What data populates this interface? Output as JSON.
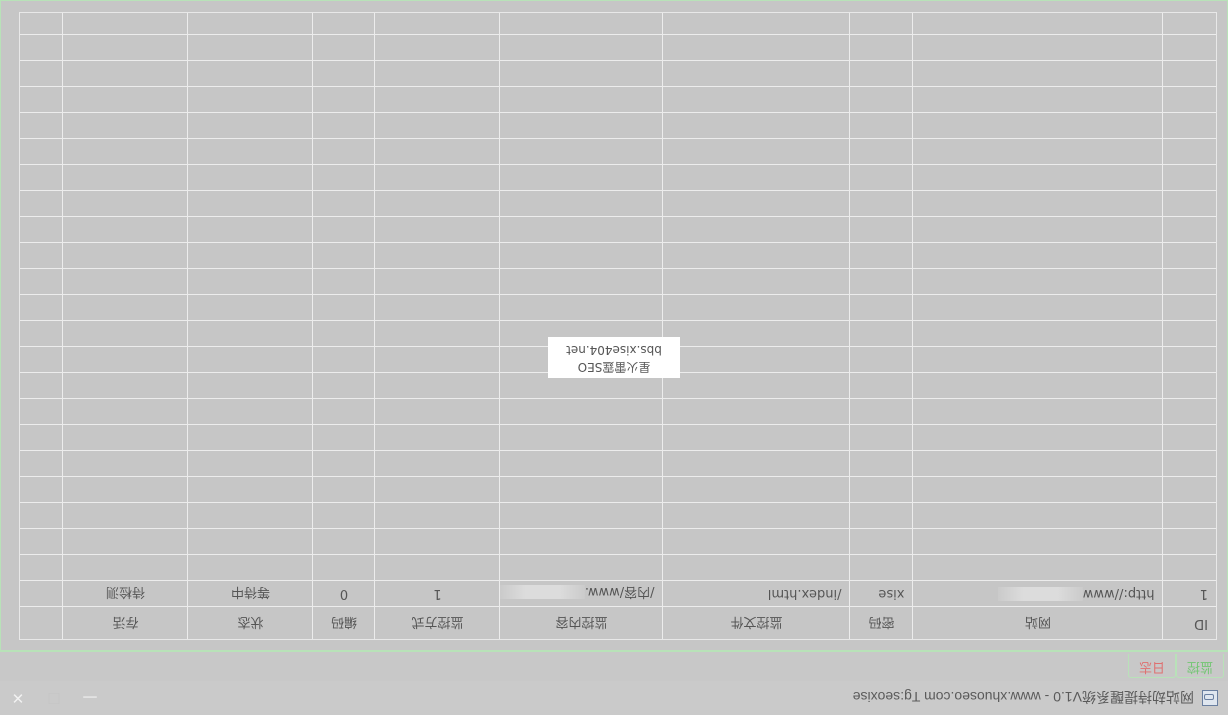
{
  "window": {
    "title": "网站劫持提醒系统V1.0 - www.xhuoseo.com Tg:seoxise",
    "controls": {
      "minimize": "—",
      "maximize": "☐",
      "close": "✕"
    }
  },
  "tabs": [
    {
      "label": "监控",
      "active": true
    },
    {
      "label": "日志",
      "active": false
    }
  ],
  "table": {
    "columns": [
      "ID",
      "网站",
      "密码",
      "监控文件",
      "监控内容",
      "监控方式",
      "编码",
      "状态",
      "存活"
    ],
    "rows": [
      {
        "id": "1",
        "site": "http://www",
        "password": "xise",
        "file": "/index.html",
        "content": "/内容/www.",
        "method": "1",
        "encoding": "0",
        "status": "等待中",
        "alive": "待检测"
      }
    ]
  },
  "watermark": {
    "line1": "星火雷霆SEO",
    "line2": "bbs.xise404.net"
  },
  "colors": {
    "monitor_tab": "#72c672",
    "log_tab": "#df7070",
    "border_green": "#b8e2b8"
  }
}
